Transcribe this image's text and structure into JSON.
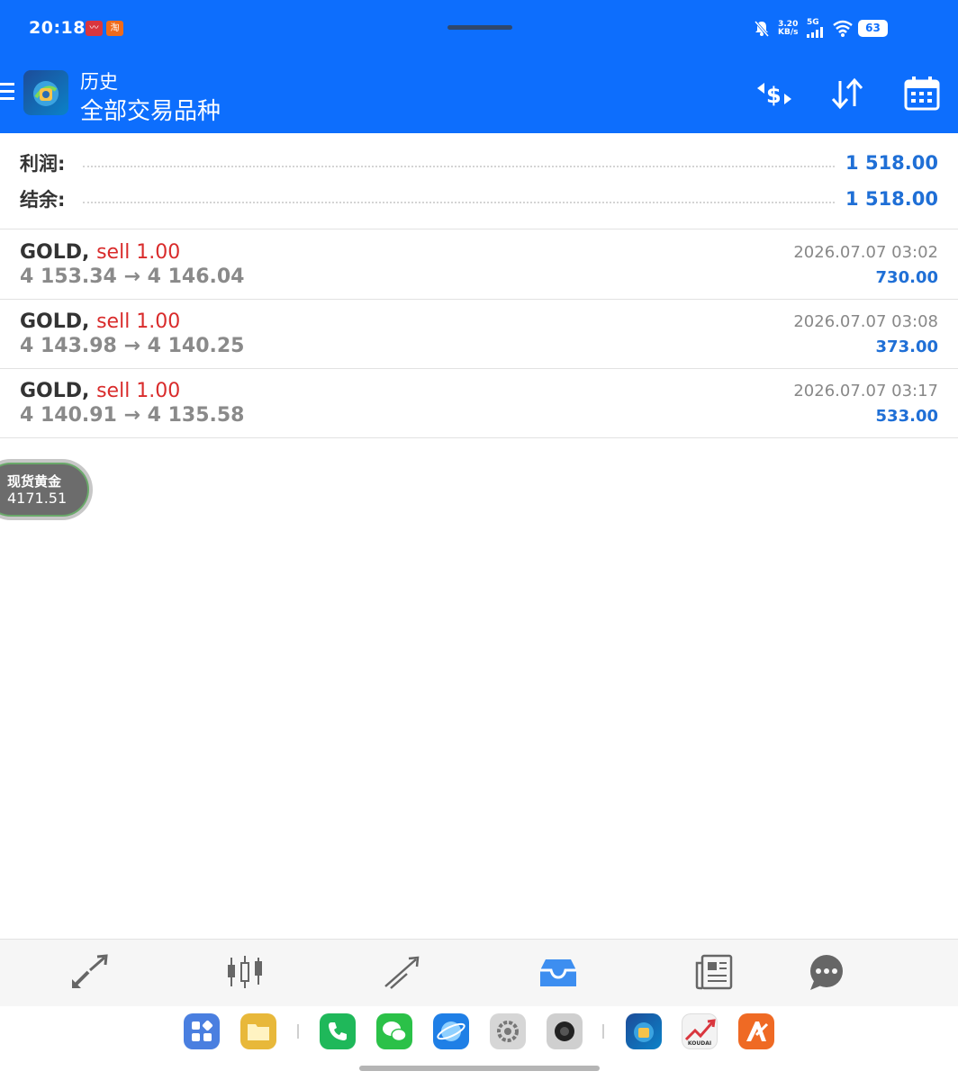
{
  "status_bar": {
    "time": "20:18",
    "notification_badges": [
      "〰",
      "淘"
    ],
    "net_speed_value": "3.20",
    "net_speed_unit": "KB/s",
    "network_type": "5G",
    "battery": "63"
  },
  "app_bar": {
    "subtitle": "历史",
    "title": "全部交易品种"
  },
  "summary": {
    "profit_label": "利润:",
    "profit_value": "1 518.00",
    "balance_label": "结余:",
    "balance_value": "1 518.00"
  },
  "deals": [
    {
      "symbol": "GOLD,",
      "type": "sell 1.00",
      "prices": "4 153.34 → 4 146.04",
      "time": "2026.07.07 03:02",
      "profit": "730.00"
    },
    {
      "symbol": "GOLD,",
      "type": "sell 1.00",
      "prices": "4 143.98 → 4 140.25",
      "time": "2026.07.07 03:08",
      "profit": "373.00"
    },
    {
      "symbol": "GOLD,",
      "type": "sell 1.00",
      "prices": "4 140.91 → 4 135.58",
      "time": "2026.07.07 03:17",
      "profit": "533.00"
    }
  ],
  "floating_widget": {
    "label": "现货黄金",
    "value": "4171.51"
  },
  "dock": {
    "koudai_label": "KOUDAI"
  },
  "colors": {
    "header_blue": "#0d6efd",
    "profit_blue": "#1f6fd6",
    "sell_red": "#d92b2b",
    "active_nav_blue": "#3d8ef0"
  },
  "icons": {
    "toolbar": [
      "currency-exchange-icon",
      "sort-icon",
      "calendar-icon"
    ],
    "bottom_nav": [
      "quotes-icon",
      "chart-icon",
      "trade-icon",
      "history-icon",
      "news-icon",
      "chat-icon"
    ],
    "active_nav": "history-icon"
  }
}
